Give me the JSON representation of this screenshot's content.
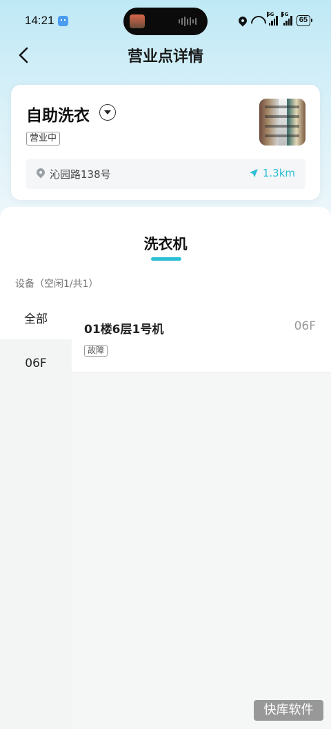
{
  "status_bar": {
    "time": "14:21",
    "battery": "65",
    "signal_1_label": "5G",
    "signal_2_label": "5G"
  },
  "nav": {
    "title": "营业点详情"
  },
  "store": {
    "name": "自助洗衣",
    "status_badge": "营业中",
    "address": "沁园路138号",
    "distance": "1.3km"
  },
  "panel": {
    "tab_label": "洗衣机",
    "device_summary": "设备（空闲1/共1）",
    "filters": [
      {
        "label": "全部"
      },
      {
        "label": "06F"
      }
    ],
    "devices": [
      {
        "name": "01楼6层1号机",
        "floor": "06F",
        "status": "故障"
      }
    ]
  },
  "watermark": "快库软件",
  "colors": {
    "accent": "#2bbfd4",
    "header_gradient_top": "#bfe9f6",
    "left_column_bg": "#f3f4f4"
  }
}
